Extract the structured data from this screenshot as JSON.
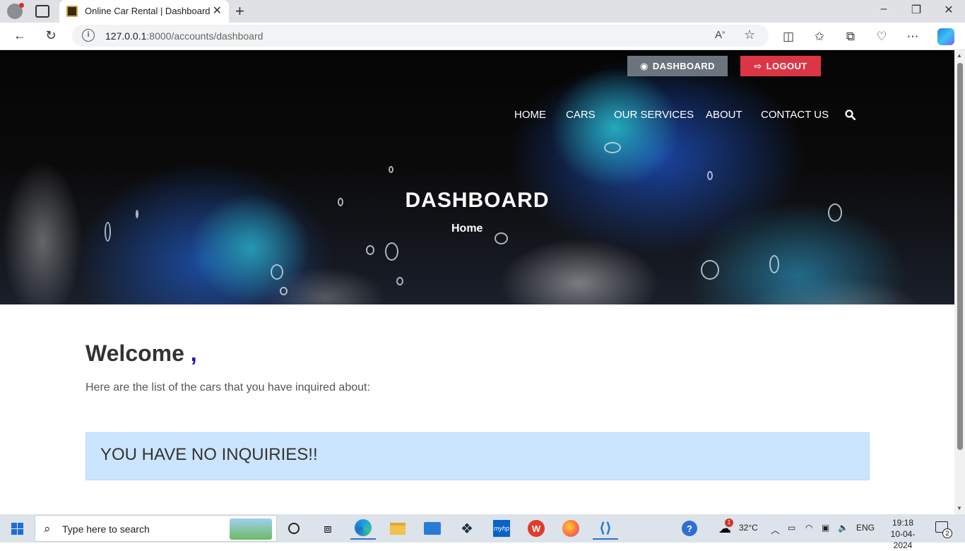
{
  "browser": {
    "tab_title": "Online Car Rental | Dashboard",
    "url_host": "127.0.0.1",
    "url_rest": ":8000/accounts/dashboard"
  },
  "header": {
    "dashboard_button": "DASHBOARD",
    "logout_button": "LOGOUT",
    "nav": [
      "HOME",
      "CARS",
      "OUR SERVICES",
      "ABOUT",
      "CONTACT US"
    ]
  },
  "hero": {
    "title": "DASHBOARD",
    "breadcrumb": "Home"
  },
  "main": {
    "welcome": "Welcome",
    "welcome_comma": ",",
    "subtext": "Here are the list of the cars that you have inquired about:",
    "alert": "YOU HAVE NO INQUIRIES!!"
  },
  "taskbar": {
    "search_placeholder": "Type here to search",
    "weather": "32°C",
    "language": "ENG",
    "time": "19:18",
    "date": "10-04-2024",
    "weather_badge": "1",
    "notification_count": "2"
  },
  "colors": {
    "dashboard_button": "#6c757d",
    "logout_button": "#dc3545",
    "alert_bg": "#cce5ff",
    "welcome_comma": "#1a0dd6"
  }
}
